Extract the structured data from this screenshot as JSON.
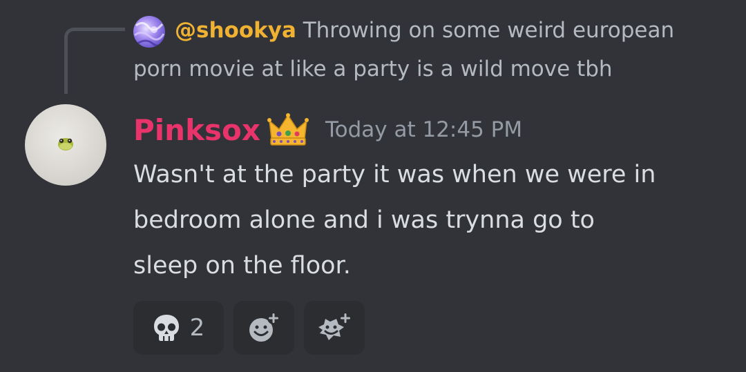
{
  "reply": {
    "author": "@shookya",
    "text_line1": "Throwing on some weird european",
    "text_line2": "porn movie at like a party is a wild move tbh"
  },
  "message": {
    "author": "Pinksox",
    "badge_icon": "crown-emoji",
    "timestamp": "Today at 12:45 PM",
    "lines": [
      "Wasn't at the party it was when we were in",
      "bedroom alone and i was trynna go to",
      "sleep on the floor."
    ]
  },
  "reactions": {
    "skull": {
      "icon": "skull-emoji",
      "count": "2"
    },
    "add_reaction_icon": "add-reaction-icon",
    "add_super_reaction_icon": "add-super-reaction-icon"
  },
  "colors": {
    "background": "#313338",
    "reply_author": "#f0b232",
    "message_author": "#e8336b",
    "text": "#dbdee1",
    "muted": "#949ba4"
  }
}
